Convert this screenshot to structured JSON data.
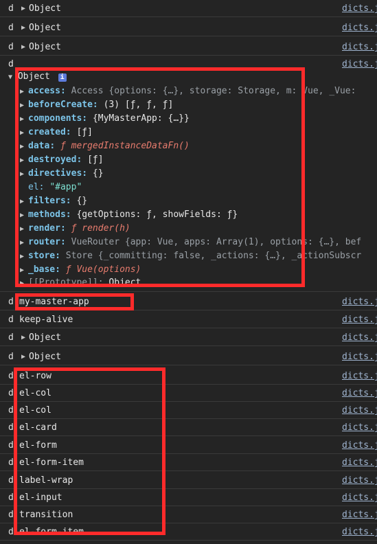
{
  "top_rows": [
    {
      "prefix": "d",
      "label": "Object",
      "source": "dicts.js"
    },
    {
      "prefix": "d",
      "label": "Object",
      "source": "dicts.js"
    },
    {
      "prefix": "d",
      "label": "Object",
      "source": "dicts.js"
    }
  ],
  "expanded": {
    "prefix": "d",
    "source": "dicts.js",
    "header": "Object",
    "properties": [
      {
        "key": "access",
        "rest": " Access {options: {…}, storage: Storage,",
        "rest2": "m: Vue, _Vue:"
      },
      {
        "key": "beforeCreate",
        "rest": " (3) [ƒ, ƒ, ƒ]"
      },
      {
        "key": "components",
        "rest": " {MyMasterApp: {…}}"
      },
      {
        "key": "created",
        "rest": " [ƒ]"
      },
      {
        "key": "data",
        "rest": "mergedInstanceDataFn()"
      },
      {
        "key": "destroyed",
        "rest": " [ƒ]"
      },
      {
        "key": "directives",
        "rest": " {}"
      },
      {
        "key": "el",
        "rest": "\"#app\""
      },
      {
        "key": "filters",
        "rest": " {}"
      },
      {
        "key": "methods",
        "rest": " {getOptions: ƒ, showFields: ƒ}"
      },
      {
        "key": "render",
        "rest": "render(h)"
      },
      {
        "key": "router",
        "rest": " VueRouter {app: Vue, apps: Array(1), options: {…}, bef"
      },
      {
        "key": "store",
        "rest": " Store {_committing: false, _actions: {…}, _actionSubscr"
      },
      {
        "key": "_base",
        "rest": "Vue(options)"
      },
      {
        "key": "[[Prototype]]",
        "rest": " Object"
      }
    ]
  },
  "bottom_rows": [
    {
      "prefix": "d",
      "label": "my-master-app",
      "source": "dicts.js"
    },
    {
      "prefix": "d",
      "label": "keep-alive",
      "source": "dicts.js"
    },
    {
      "prefix": "d",
      "label": "Object",
      "source": "dicts.js",
      "expandable": true
    },
    {
      "prefix": "d",
      "label": "Object",
      "source": "dicts.js",
      "expandable": true
    },
    {
      "prefix": "d",
      "label": "el-row",
      "source": "dicts.js"
    },
    {
      "prefix": "d",
      "label": "el-col",
      "source": "dicts.js"
    },
    {
      "prefix": "d",
      "label": "el-col",
      "source": "dicts.js"
    },
    {
      "prefix": "d",
      "label": "el-card",
      "source": "dicts.js"
    },
    {
      "prefix": "d",
      "label": "el-form",
      "source": "dicts.js"
    },
    {
      "prefix": "d",
      "label": "el-form-item",
      "source": "dicts.js"
    },
    {
      "prefix": "d",
      "label": "label-wrap",
      "source": "dicts.js"
    },
    {
      "prefix": "d",
      "label": "el-input",
      "source": "dicts.js"
    },
    {
      "prefix": "d",
      "label": "transition",
      "source": "dicts.js"
    },
    {
      "prefix": "d",
      "label": "el-form-item",
      "source": "dicts.js"
    }
  ],
  "colors": {
    "highlight": "#ff2b2b",
    "background": "#242424",
    "link": "#9fb4cf",
    "key": "#7cc4e8"
  }
}
